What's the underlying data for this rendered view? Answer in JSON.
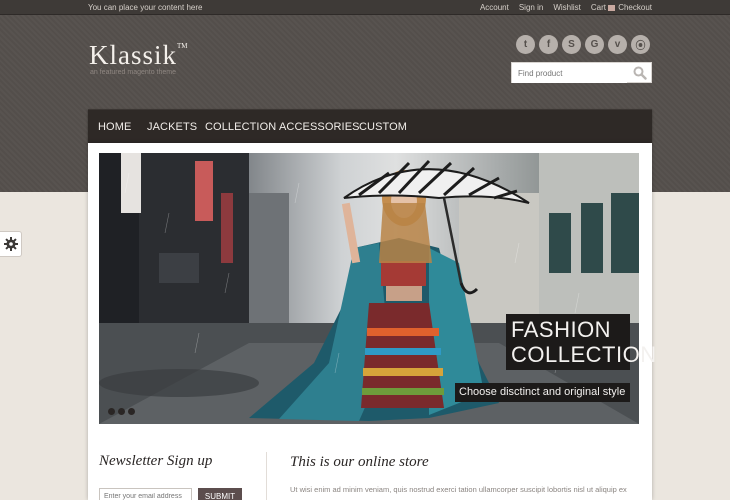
{
  "topbar": {
    "message": "You can place your content here",
    "links": [
      "Account",
      "Sign in",
      "Wishlist",
      "Cart"
    ],
    "checkout": "Checkout"
  },
  "logo": {
    "name": "Klassik",
    "tm": "TM",
    "tagline": "an featured magento theme"
  },
  "social": [
    {
      "icon": "twitter-icon",
      "glyph": "t"
    },
    {
      "icon": "facebook-icon",
      "glyph": "f"
    },
    {
      "icon": "skype-icon",
      "glyph": "S"
    },
    {
      "icon": "google-icon",
      "glyph": "G"
    },
    {
      "icon": "vimeo-icon",
      "glyph": "v"
    },
    {
      "icon": "rss-icon",
      "glyph": "⦿"
    }
  ],
  "search": {
    "placeholder": "Find product"
  },
  "nav": [
    "HOME",
    "JACKETS",
    "COLLECTION",
    "ACCESSORIES",
    "CUSTOM"
  ],
  "hero": {
    "title_line1": "FASHION",
    "title_line2": "COLLECTION",
    "subtitle": "Choose disctinct and original style",
    "slides": 3
  },
  "newsletter": {
    "title": "Newsletter Sign up",
    "placeholder": "Enter your email address",
    "submit": "SUBMIT"
  },
  "store": {
    "title": "This is our online store",
    "body": "Ut wisi enim ad minim veniam, quis nostrud exerci tation ullamcorper suscipit lobortis nisl ut aliquip ex"
  },
  "colors": {
    "header": "#55504c",
    "nav": "#2e2926",
    "page_bg": "#ebe6df",
    "submit": "#5c4d4d"
  }
}
